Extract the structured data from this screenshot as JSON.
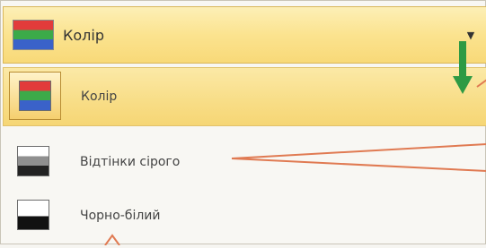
{
  "combo": {
    "label": "Колір",
    "icon": "color-bars-icon",
    "dropdown_icon": "triangle-down-icon"
  },
  "menu": {
    "items": [
      {
        "label": "Колір",
        "icon": "color-bars-icon",
        "selected": true
      },
      {
        "label": "Відтінки сірого",
        "icon": "grayscale-bars-icon",
        "selected": false
      },
      {
        "label": "Чорно-білий",
        "icon": "black-white-icon",
        "selected": false
      }
    ]
  },
  "colors": {
    "selection_fill": "#f8dd86",
    "selection_border": "#e1c26c",
    "annotation_orange": "#e07a52",
    "annotation_green": "#2e9a44"
  }
}
